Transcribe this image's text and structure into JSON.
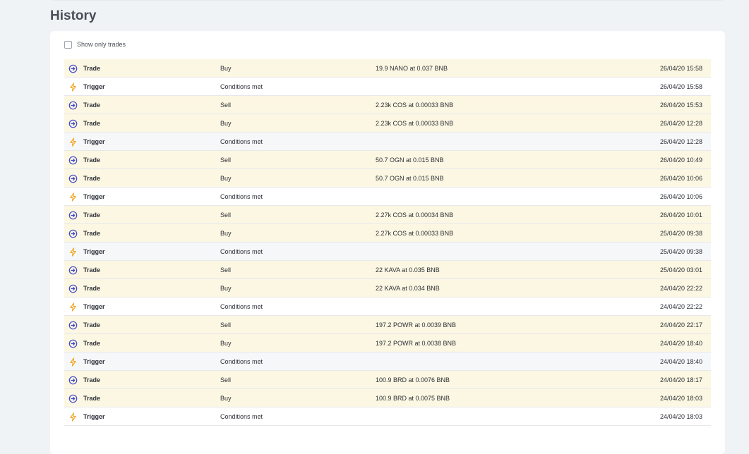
{
  "section": {
    "title": "History"
  },
  "filter": {
    "label": "Show only trades",
    "checked": false
  },
  "colors": {
    "trade_row": "#fcf7e2",
    "trade_icon": "#3d46c8",
    "trigger_icon": "#f2a21b"
  },
  "rows": [
    {
      "type": "trade",
      "icon": "trade-icon",
      "kind": "Trade",
      "action": "Buy",
      "detail": "19.9 NANO  at  0.037 BNB",
      "time": "26/04/20 15:58"
    },
    {
      "type": "trigger",
      "icon": "lightning-icon",
      "kind": "Trigger",
      "action": "Conditions met",
      "detail": "",
      "time": "26/04/20 15:58"
    },
    {
      "type": "trade",
      "icon": "trade-icon",
      "kind": "Trade",
      "action": "Sell",
      "detail": "2.23k COS  at  0.00033 BNB",
      "time": "26/04/20 15:53"
    },
    {
      "type": "trade",
      "icon": "trade-icon",
      "kind": "Trade",
      "action": "Buy",
      "detail": "2.23k COS  at  0.00033 BNB",
      "time": "26/04/20 12:28"
    },
    {
      "type": "trigger",
      "icon": "lightning-icon",
      "kind": "Trigger",
      "action": "Conditions met",
      "detail": "",
      "time": "26/04/20 12:28"
    },
    {
      "type": "trade",
      "icon": "trade-icon",
      "kind": "Trade",
      "action": "Sell",
      "detail": "50.7 OGN  at  0.015 BNB",
      "time": "26/04/20 10:49"
    },
    {
      "type": "trade",
      "icon": "trade-icon",
      "kind": "Trade",
      "action": "Buy",
      "detail": "50.7 OGN  at  0.015 BNB",
      "time": "26/04/20 10:06"
    },
    {
      "type": "trigger",
      "icon": "lightning-icon",
      "kind": "Trigger",
      "action": "Conditions met",
      "detail": "",
      "time": "26/04/20 10:06"
    },
    {
      "type": "trade",
      "icon": "trade-icon",
      "kind": "Trade",
      "action": "Sell",
      "detail": "2.27k COS  at  0.00034 BNB",
      "time": "26/04/20 10:01"
    },
    {
      "type": "trade",
      "icon": "trade-icon",
      "kind": "Trade",
      "action": "Buy",
      "detail": "2.27k COS  at  0.00033 BNB",
      "time": "25/04/20 09:38"
    },
    {
      "type": "trigger",
      "icon": "lightning-icon",
      "kind": "Trigger",
      "action": "Conditions met",
      "detail": "",
      "time": "25/04/20 09:38"
    },
    {
      "type": "trade",
      "icon": "trade-icon",
      "kind": "Trade",
      "action": "Sell",
      "detail": "22 KAVA  at  0.035 BNB",
      "time": "25/04/20 03:01"
    },
    {
      "type": "trade",
      "icon": "trade-icon",
      "kind": "Trade",
      "action": "Buy",
      "detail": "22 KAVA  at  0.034 BNB",
      "time": "24/04/20 22:22"
    },
    {
      "type": "trigger",
      "icon": "lightning-icon",
      "kind": "Trigger",
      "action": "Conditions met",
      "detail": "",
      "time": "24/04/20 22:22"
    },
    {
      "type": "trade",
      "icon": "trade-icon",
      "kind": "Trade",
      "action": "Sell",
      "detail": "197.2 POWR  at  0.0039 BNB",
      "time": "24/04/20 22:17"
    },
    {
      "type": "trade",
      "icon": "trade-icon",
      "kind": "Trade",
      "action": "Buy",
      "detail": "197.2 POWR  at  0.0038 BNB",
      "time": "24/04/20 18:40"
    },
    {
      "type": "trigger",
      "icon": "lightning-icon",
      "kind": "Trigger",
      "action": "Conditions met",
      "detail": "",
      "time": "24/04/20 18:40"
    },
    {
      "type": "trade",
      "icon": "trade-icon",
      "kind": "Trade",
      "action": "Sell",
      "detail": "100.9 BRD  at  0.0076 BNB",
      "time": "24/04/20 18:17"
    },
    {
      "type": "trade",
      "icon": "trade-icon",
      "kind": "Trade",
      "action": "Buy",
      "detail": "100.9 BRD  at  0.0075 BNB",
      "time": "24/04/20 18:03"
    },
    {
      "type": "trigger",
      "icon": "lightning-icon",
      "kind": "Trigger",
      "action": "Conditions met",
      "detail": "",
      "time": "24/04/20 18:03"
    }
  ]
}
